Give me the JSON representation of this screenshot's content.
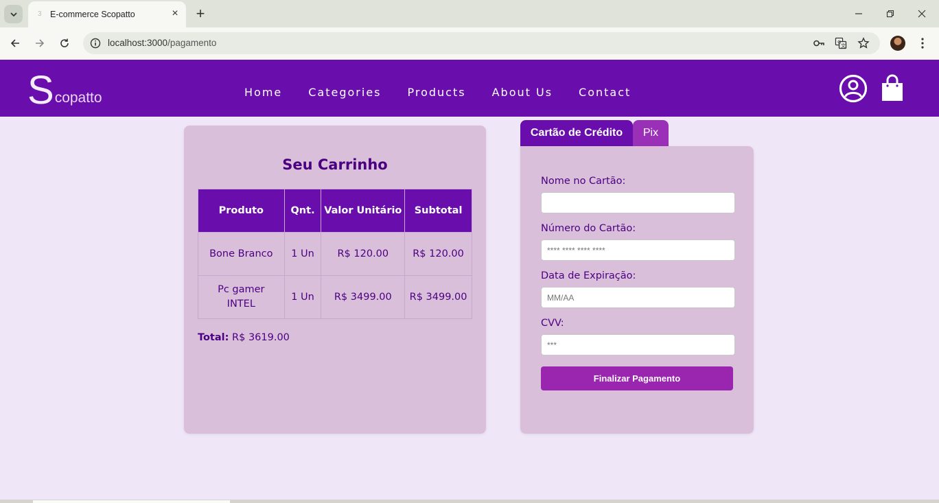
{
  "browser": {
    "tab_title": "E-commerce Scopatto",
    "url_host": "localhost:3000",
    "url_path": "/pagamento"
  },
  "site": {
    "logo_initial": "S",
    "logo_rest": "copatto",
    "nav": [
      "Home",
      "Categories",
      "Products",
      "About Us",
      "Contact"
    ],
    "icons": [
      "user-circle-icon",
      "shopping-bag-icon"
    ]
  },
  "cart": {
    "title": "Seu Carrinho",
    "headers": [
      "Produto",
      "Qnt.",
      "Valor Unitário",
      "Subtotal"
    ],
    "rows": [
      [
        "Bone Branco",
        "1 Un",
        "R$ 120.00",
        "R$ 120.00"
      ],
      [
        "Pc gamer INTEL",
        "1 Un",
        "R$ 3499.00",
        "R$ 3499.00"
      ]
    ],
    "total_label": "Total:",
    "total_value": "R$ 3619.00"
  },
  "payment": {
    "tabs": [
      "Cartão de Crédito",
      "Pix"
    ],
    "fields": [
      {
        "label": "Nome no Cartão:",
        "placeholder": "",
        "value": ""
      },
      {
        "label": "Número do Cartão:",
        "placeholder": "**** **** **** ****",
        "value": ""
      },
      {
        "label": "Data de Expiração:",
        "placeholder": "MM/AA",
        "value": ""
      },
      {
        "label": "CVV:",
        "placeholder": "***",
        "value": ""
      }
    ],
    "submit_label": "Finalizar Pagamento"
  },
  "colors": {
    "brand_purple": "#6a0dad",
    "accent_purple": "#9a25ae",
    "card_bg": "#d9bfd9",
    "page_bg": "#efe7f7",
    "text_dark_purple": "#4b0082"
  }
}
